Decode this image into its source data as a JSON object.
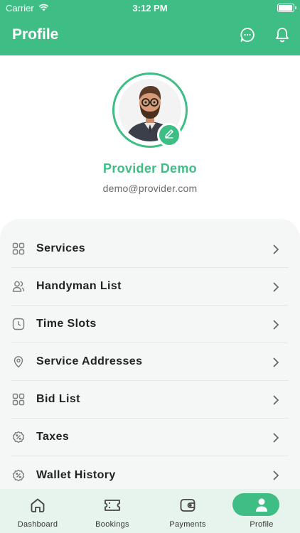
{
  "status_bar": {
    "carrier": "Carrier",
    "time": "3:12 PM",
    "battery_level": 1.0
  },
  "header": {
    "title": "Profile",
    "icons": [
      "chat-icon",
      "bell-icon"
    ],
    "background_color": "#3ebe84"
  },
  "profile": {
    "name": "Provider Demo",
    "email": "demo@provider.com",
    "edit_icon": "pencil-icon"
  },
  "menu": {
    "items": [
      {
        "label": "Services",
        "icon": "grid-icon"
      },
      {
        "label": "Handyman List",
        "icon": "users-icon"
      },
      {
        "label": "Time Slots",
        "icon": "clock-icon"
      },
      {
        "label": "Service Addresses",
        "icon": "location-pin-icon"
      },
      {
        "label": "Bid List",
        "icon": "grid-icon"
      },
      {
        "label": "Taxes",
        "icon": "percent-badge-icon"
      },
      {
        "label": "Wallet History",
        "icon": "percent-badge-icon"
      }
    ]
  },
  "bottom_nav": {
    "items": [
      {
        "label": "Dashboard",
        "icon": "home-icon",
        "active": false
      },
      {
        "label": "Bookings",
        "icon": "ticket-icon",
        "active": false
      },
      {
        "label": "Payments",
        "icon": "wallet-icon",
        "active": false
      },
      {
        "label": "Profile",
        "icon": "person-icon",
        "active": true
      }
    ]
  },
  "colors": {
    "accent": "#3ebe84",
    "menu_background": "#f5f7f6",
    "nav_background": "#e6f4ed"
  }
}
